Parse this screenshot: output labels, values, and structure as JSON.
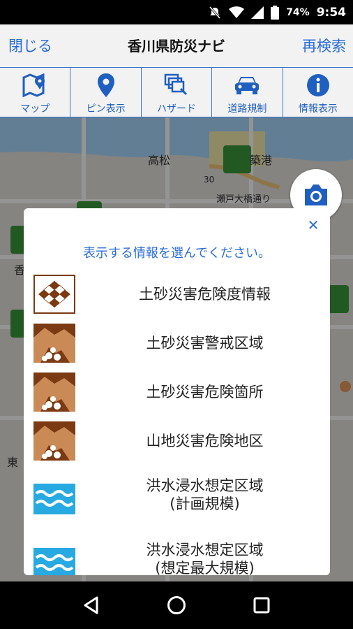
{
  "status": {
    "battery": "74%",
    "time": "9:54"
  },
  "header": {
    "close": "閉じる",
    "title": "香川県防災ナビ",
    "research": "再検索"
  },
  "toolbar": [
    {
      "label": "マップ",
      "icon": "map-icon"
    },
    {
      "label": "ピン表示",
      "icon": "pin-icon"
    },
    {
      "label": "ハザード",
      "icon": "hazard-icon"
    },
    {
      "label": "道路規制",
      "icon": "car-icon"
    },
    {
      "label": "情報表示",
      "icon": "info-icon"
    }
  ],
  "map": {
    "labels": {
      "takamatsu": "高松",
      "port": "築港",
      "road_num": "30",
      "setoohashi": "瀬戸大橋通り",
      "ka": "香",
      "hi": "東"
    }
  },
  "dialog": {
    "prompt": "表示する情報を選んでください。",
    "items": [
      {
        "line1": "土砂災害危険度情報",
        "line2": "",
        "icon": "grid-risk-icon"
      },
      {
        "line1": "土砂災害警戒区域",
        "line2": "",
        "icon": "landslide-icon"
      },
      {
        "line1": "土砂災害危険箇所",
        "line2": "",
        "icon": "landslide-icon"
      },
      {
        "line1": "山地災害危険地区",
        "line2": "",
        "icon": "landslide-icon"
      },
      {
        "line1": "洪水浸水想定区域",
        "line2": "(計画規模)",
        "icon": "flood-icon"
      },
      {
        "line1": "洪水浸水想定区域",
        "line2": "(想定最大規模)",
        "icon": "flood-icon"
      }
    ]
  },
  "colors": {
    "accent": "#2a6cd6",
    "landslide": "#7b3a12",
    "flood": "#27a9e1"
  }
}
